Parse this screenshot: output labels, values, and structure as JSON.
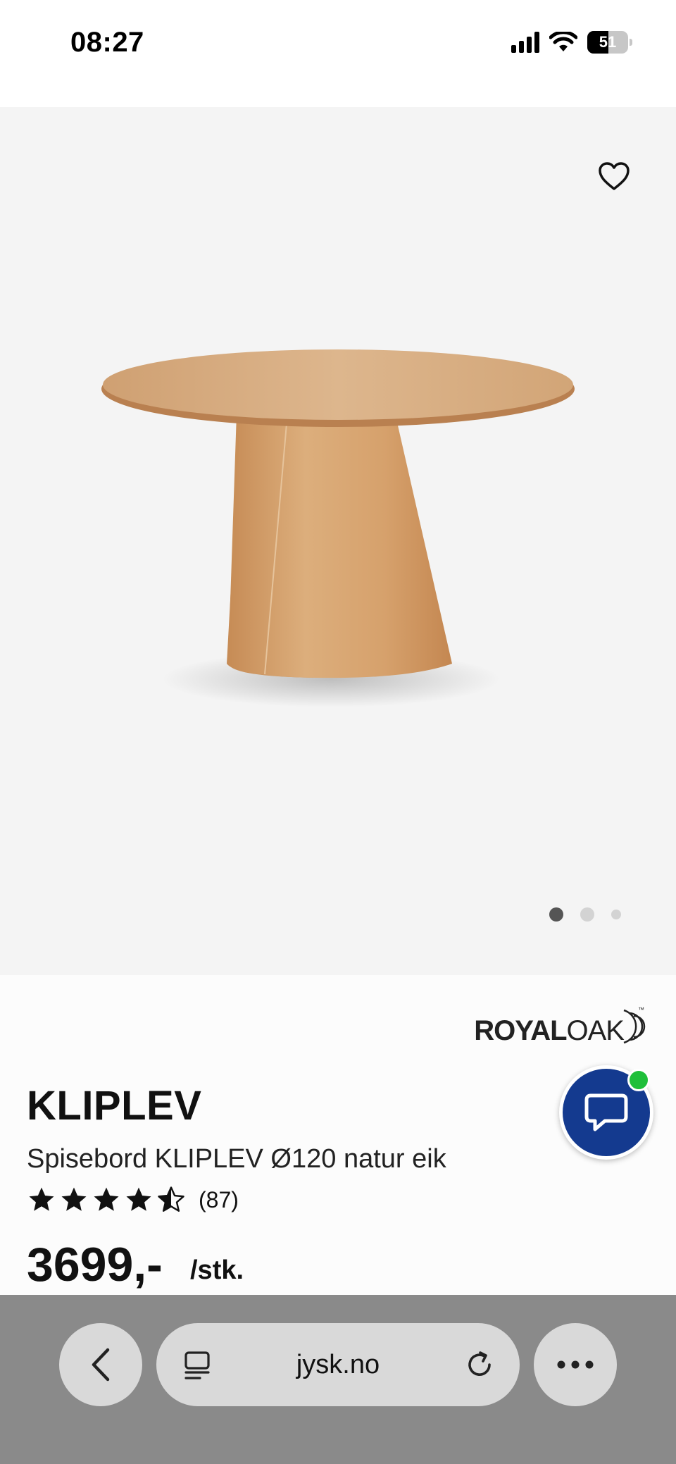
{
  "status_bar": {
    "time": "08:27",
    "battery_level": "51",
    "battery_fraction": 0.51
  },
  "product": {
    "brand": {
      "bold": "ROYAL",
      "light": "OAK",
      "tm": "™"
    },
    "name": "KLIPLEV",
    "description": "Spisebord KLIPLEV Ø120 natur eik",
    "rating_value": 4.5,
    "rating_max": 5,
    "reviews": "(87)",
    "price": "3699,-",
    "unit": "/stk.",
    "gallery_images": 3,
    "gallery_active_index": 0
  },
  "browser": {
    "url": "jysk.no"
  },
  "icons": {
    "favorite": "heart-outline-icon",
    "chat": "chat-bubble-icon",
    "back": "chevron-left-icon",
    "tabs": "tab-list-icon",
    "reload": "reload-icon",
    "more": "ellipsis-icon"
  },
  "colors": {
    "chat_button": "#143a8f",
    "online_dot": "#1fbf3a",
    "image_bg": "#f4f4f4"
  }
}
